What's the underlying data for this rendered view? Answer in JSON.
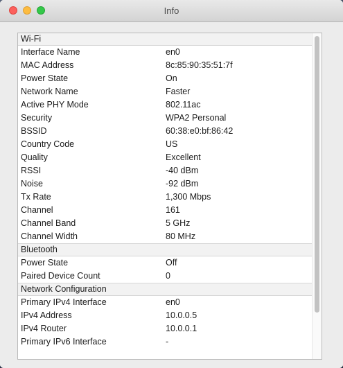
{
  "window": {
    "title": "Info"
  },
  "scroll": {
    "position_fraction": 0.0,
    "visible_fraction": 0.86
  },
  "sections": [
    {
      "label": "Wi-Fi",
      "rows": [
        {
          "key": "Interface Name",
          "value": "en0"
        },
        {
          "key": "MAC Address",
          "value": "8c:85:90:35:51:7f"
        },
        {
          "key": "Power State",
          "value": "On"
        },
        {
          "key": "Network Name",
          "value": "Faster"
        },
        {
          "key": "Active PHY Mode",
          "value": "802.11ac"
        },
        {
          "key": "Security",
          "value": "WPA2 Personal"
        },
        {
          "key": "BSSID",
          "value": "60:38:e0:bf:86:42"
        },
        {
          "key": "Country Code",
          "value": "US"
        },
        {
          "key": "Quality",
          "value": "Excellent"
        },
        {
          "key": "RSSI",
          "value": "-40 dBm"
        },
        {
          "key": "Noise",
          "value": "-92 dBm"
        },
        {
          "key": "Tx Rate",
          "value": "1,300 Mbps"
        },
        {
          "key": "Channel",
          "value": "161"
        },
        {
          "key": "Channel Band",
          "value": "5 GHz"
        },
        {
          "key": "Channel Width",
          "value": "80 MHz"
        }
      ]
    },
    {
      "label": "Bluetooth",
      "rows": [
        {
          "key": "Power State",
          "value": "Off"
        },
        {
          "key": "Paired Device Count",
          "value": "0"
        }
      ]
    },
    {
      "label": "Network Configuration",
      "rows": [
        {
          "key": "Primary IPv4 Interface",
          "value": "en0"
        },
        {
          "key": "IPv4 Address",
          "value": "10.0.0.5"
        },
        {
          "key": "IPv4 Router",
          "value": "10.0.0.1"
        },
        {
          "key": "Primary IPv6 Interface",
          "value": "-"
        }
      ]
    }
  ]
}
